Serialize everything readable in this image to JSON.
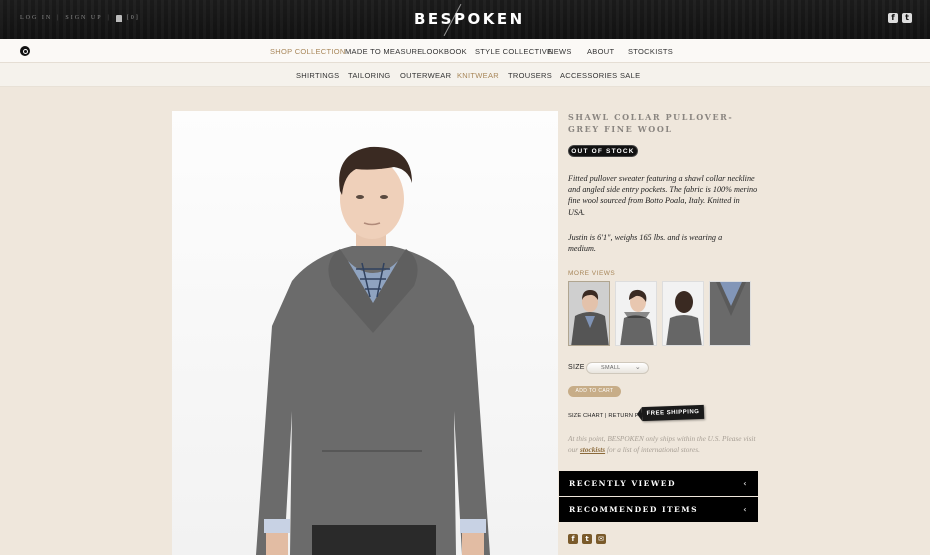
{
  "top": {
    "login": "LOG IN",
    "signup": "SIGN UP",
    "cart_count": "[0]",
    "logo": "BESPOKEN"
  },
  "nav_primary": [
    {
      "label": "SHOP COLLECTION",
      "active": true
    },
    {
      "label": "MADE TO MEASURE",
      "active": false
    },
    {
      "label": "LOOKBOOK",
      "active": false
    },
    {
      "label": "STYLE COLLECTIVE",
      "active": false
    },
    {
      "label": "NEWS",
      "active": false
    },
    {
      "label": "ABOUT",
      "active": false
    },
    {
      "label": "STOCKISTS",
      "active": false
    }
  ],
  "nav_secondary": [
    {
      "label": "SHIRTINGS",
      "active": false
    },
    {
      "label": "TAILORING",
      "active": false
    },
    {
      "label": "OUTERWEAR",
      "active": false
    },
    {
      "label": "KNITWEAR",
      "active": true
    },
    {
      "label": "TROUSERS",
      "active": false
    },
    {
      "label": "ACCESSORIES",
      "active": false
    },
    {
      "label": "SALE",
      "active": false
    }
  ],
  "product": {
    "title": "SHAWL COLLAR PULLOVER- GREY FINE WOOL",
    "stock_badge": "OUT OF STOCK",
    "description": "Fitted pullover sweater featuring a shawl collar neckline and angled side entry pockets. The fabric is 100% merino fine wool sourced from Botto Poala, Italy. Knitted in USA.",
    "fit_note": "Justin is 6'1\", weighs 165 lbs. and is wearing a medium.",
    "more_views_label": "MORE VIEWS",
    "size_label": "SIZE",
    "size_value": "SMALL",
    "add_to_cart": "ADD TO CART",
    "size_chart": "SIZE CHART",
    "links_sep": "|",
    "return_policy": "RETURN POLICY",
    "free_shipping": "FREE SHIPPING",
    "shipping_note_pre": "At this point, BESPOKEN only ships within the U.S. Please visit our ",
    "shipping_note_link": "stockists",
    "shipping_note_post": " for a list of international stores."
  },
  "accordions": {
    "recently_viewed": "RECENTLY VIEWED",
    "recommended": "RECOMMENDED ITEMS"
  },
  "icons": {
    "facebook": "f",
    "twitter": "t",
    "email": "✉",
    "chevron": "‹"
  },
  "colors": {
    "accent": "#a8875a",
    "sweater": "#6b6b6b"
  }
}
